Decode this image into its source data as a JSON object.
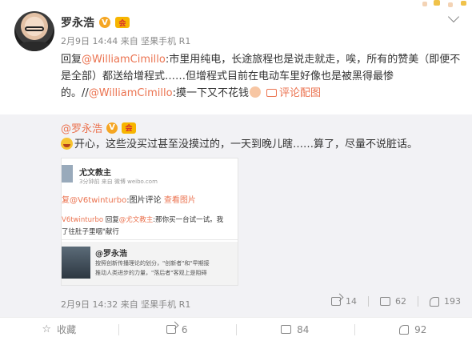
{
  "post": {
    "author": "罗永浩",
    "vip_label": "V",
    "member_label": "会",
    "meta": "2月9日 14:44 来自 坚果手机 R1",
    "text_reply": "回复",
    "mention1": "@WilliamCimillo",
    "text_body": ":市里用纯电，长途旅程也是说走就走，唉，所有的赞美（即便不是全部）都送给增程式……但增程式目前在电动车里好像也是被黑得最惨的。//",
    "mention2": "@WilliamCimillo",
    "text_tail": ":摸一下又不花钱",
    "piclink": "评论配图"
  },
  "repost": {
    "author": "@罗永浩",
    "text": "开心，这些没买过甚至没摸过的，一天到晚儿瞎……算了，尽量不说脏话。",
    "meta": "2月9日 14:32 来自 坚果手机 R1",
    "share_count": "14",
    "comment_count": "62",
    "like_count": "193",
    "image": {
      "name": "尤文教主",
      "meta": "3分钟前 来自 微博 weibo.com",
      "line1_link": "复@V6twinturbo",
      "line1_text": ":图片评论",
      "line1_view": "查看图片",
      "line2_link": "V6twinturbo",
      "line2_a": " 回复",
      "line2_mention": "@尤文教主",
      "line2_b": ":那你买一台试一试。我",
      "line3": "了往肚子里咽\"献行",
      "quote_name": "@罗永浩",
      "quote_line1": "按照创新传播理论的划分，\"创新者\"和\"早期接",
      "quote_line2": "推动人类进步的力量，\"落后者\"客观上是阻碍"
    }
  },
  "actions": {
    "favorite": "收藏",
    "share": "6",
    "comment": "84",
    "like": "92"
  },
  "colors": {
    "accent": "#eb7350",
    "muted": "#888888",
    "repost_bg": "#f2f2f5"
  },
  "icons": [
    "avatar",
    "vip-icon",
    "member-icon",
    "chevron-down-icon",
    "laugh-emoji-icon",
    "share-icon",
    "comment-icon",
    "like-icon",
    "star-icon"
  ]
}
